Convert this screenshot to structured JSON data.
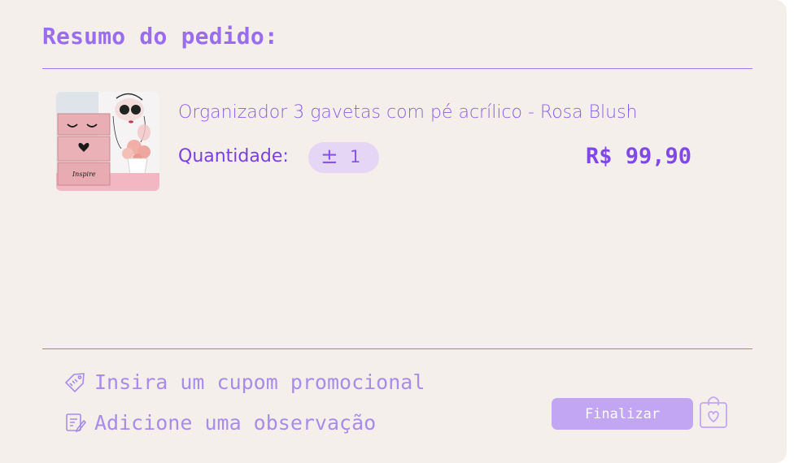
{
  "summary": {
    "title": "Resumo do pedido:"
  },
  "cart_item": {
    "name": "Organizador 3 gavetas com pé acrílico - Rosa Blush",
    "quantity_label": "Quantidade:",
    "stepper_symbol": "±",
    "quantity": "1",
    "price": "R$ 99,90",
    "image_text": "Inspire"
  },
  "actions": {
    "coupon_label": "Insira um cupom promocional",
    "note_label": "Adicione uma observação",
    "finalize_label": "Finalizar"
  },
  "icons": {
    "coupon": "tag-icon",
    "note": "note-edit-icon",
    "bag": "shopping-bag-heart-icon"
  },
  "colors": {
    "accent": "#9a6cf0",
    "background": "#f4efeb",
    "button": "#c2a6f4",
    "pill": "#e4d6f4"
  }
}
